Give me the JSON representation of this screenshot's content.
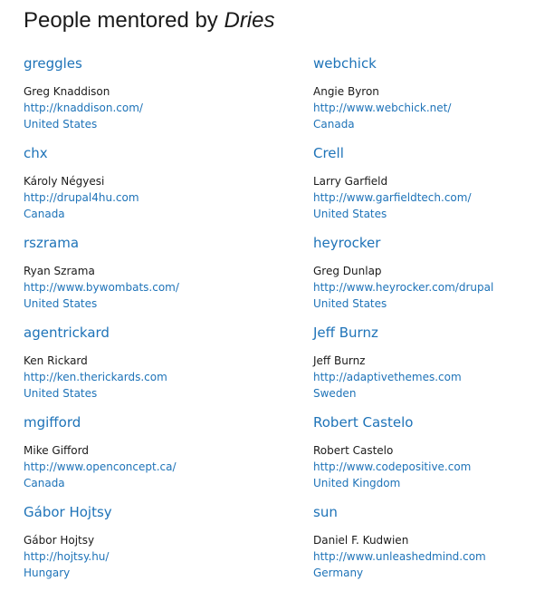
{
  "page": {
    "title_prefix": "People mentored by ",
    "title_name": "Dries"
  },
  "colors": {
    "link": "#1e73b8",
    "text": "#1a1a1a"
  },
  "people": [
    {
      "username": "greggles",
      "name": "Greg Knaddison",
      "url": "http://knaddison.com/",
      "country": "United States"
    },
    {
      "username": "webchick",
      "name": "Angie Byron",
      "url": "http://www.webchick.net/",
      "country": "Canada"
    },
    {
      "username": "chx",
      "name": "Károly Négyesi",
      "url": "http://drupal4hu.com",
      "country": "Canada"
    },
    {
      "username": "Crell",
      "name": "Larry Garfield",
      "url": "http://www.garfieldtech.com/",
      "country": "United States"
    },
    {
      "username": "rszrama",
      "name": "Ryan Szrama",
      "url": "http://www.bywombats.com/",
      "country": "United States"
    },
    {
      "username": "heyrocker",
      "name": "Greg Dunlap",
      "url": "http://www.heyrocker.com/drupal",
      "country": "United States"
    },
    {
      "username": "agentrickard",
      "name": "Ken Rickard",
      "url": "http://ken.therickards.com",
      "country": "United States"
    },
    {
      "username": "Jeff Burnz",
      "name": "Jeff Burnz",
      "url": "http://adaptivethemes.com",
      "country": "Sweden"
    },
    {
      "username": "mgifford",
      "name": "Mike Gifford",
      "url": "http://www.openconcept.ca/",
      "country": "Canada"
    },
    {
      "username": "Robert Castelo",
      "name": "Robert Castelo",
      "url": "http://www.codepositive.com",
      "country": "United Kingdom"
    },
    {
      "username": "Gábor Hojtsy",
      "name": "Gábor Hojtsy",
      "url": "http://hojtsy.hu/",
      "country": "Hungary"
    },
    {
      "username": "sun",
      "name": "Daniel F. Kudwien",
      "url": "http://www.unleashedmind.com",
      "country": "Germany"
    }
  ]
}
